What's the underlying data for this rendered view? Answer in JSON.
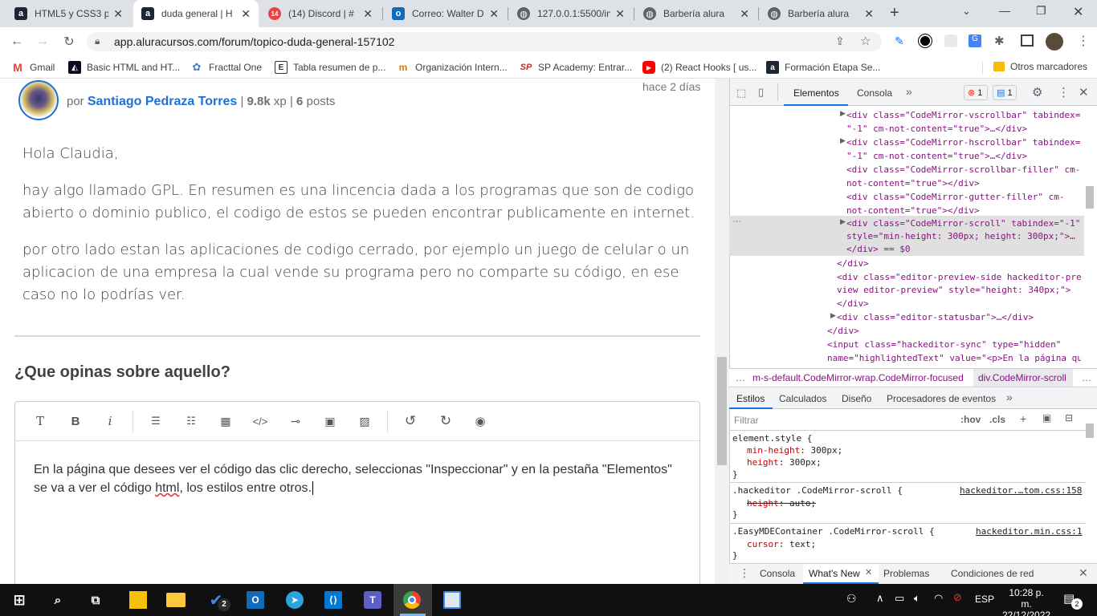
{
  "browser": {
    "tabs": [
      {
        "title": "HTML5 y CSS3 pa",
        "icon": "alura-icon",
        "active": false
      },
      {
        "title": "duda general | H",
        "icon": "alura-icon",
        "active": true
      },
      {
        "title": "(14) Discord | #",
        "icon": "discord-icon",
        "badge": "14",
        "active": false
      },
      {
        "title": "Correo: Walter D",
        "icon": "outlook-icon",
        "active": false
      },
      {
        "title": "127.0.0.1:5500/in",
        "icon": "globe-icon",
        "active": false
      },
      {
        "title": "Barbería alura",
        "icon": "globe-icon",
        "active": false
      },
      {
        "title": "Barbería alura",
        "icon": "globe-icon",
        "active": false
      }
    ],
    "url": "app.aluracursos.com/forum/topico-duda-general-157102",
    "bookmarks": [
      {
        "label": "Gmail",
        "icon": "gmail-icon"
      },
      {
        "label": "Basic HTML and HT...",
        "icon": "freecodecamp-icon"
      },
      {
        "label": "Fracttal One",
        "icon": "fracttal-icon"
      },
      {
        "label": "Tabla resumen de p...",
        "icon": "e-icon"
      },
      {
        "label": "Organización Intern...",
        "icon": "org-icon"
      },
      {
        "label": "SP Academy: Entrar...",
        "icon": "sp-icon"
      },
      {
        "label": "(2) React Hooks [ us...",
        "icon": "youtube-icon"
      },
      {
        "label": "Formación Etapa Se...",
        "icon": "alura-icon"
      }
    ],
    "other_bookmarks": "Otros marcadores"
  },
  "post": {
    "time": "hace 2 días",
    "by": "por",
    "author": "Santiago Pedraza Torres",
    "xp_value": "9.8k",
    "xp_label": "xp",
    "posts_value": "6",
    "posts_label": "posts",
    "paragraphs": [
      "Hola Claudia,",
      "hay algo llamado GPL. En resumen es una lincencia dada a los programas que son de codigo abierto o dominio publico, el codigo de estos se pueden encontrar publicamente en internet.",
      "por otro lado estan las aplicaciones de codigo cerrado, por ejemplo un juego de celular o un aplicacion de una empresa la cual vende su programa pero no comparte su código, en ese caso no lo podrías ver."
    ]
  },
  "reply": {
    "heading": "¿Que opinas sobre aquello?",
    "toolbar_icons": [
      "heading-icon",
      "bold-icon",
      "italic-icon",
      "ordered-list-icon",
      "unordered-list-icon",
      "table-icon",
      "code-icon",
      "link-icon",
      "image-icon",
      "upload-image-icon",
      "undo-icon",
      "redo-icon",
      "preview-icon"
    ],
    "text_before": "En la página que desees ver el código das clic derecho, seleccionas \"Inspeccionar\" y en la pestaña \"Elementos\" se va a ver el código ",
    "text_underlined": "html",
    "text_after": ", los estilos entre otros."
  },
  "devtools": {
    "tabs": [
      "Elementos",
      "Consola"
    ],
    "errors": "1",
    "messages": "1",
    "dom_lines": [
      "<div class=\"CodeMirror-vscrollbar\" tabindex=",
      "\"-1\" cm-not-content=\"true\">…</div>",
      "<div class=\"CodeMirror-hscrollbar\" tabindex=",
      "\"-1\" cm-not-content=\"true\">…</div>",
      "<div class=\"CodeMirror-scrollbar-filler\" cm-",
      "not-content=\"true\"></div>",
      "<div class=\"CodeMirror-gutter-filler\" cm-",
      "not-content=\"true\"></div>",
      "<div class=\"CodeMirror-scroll\" tabindex=\"-1\"",
      "style=\"min-height: 300px; height: 300px;\">…",
      "</div> == $0",
      "</div>",
      "<div class=\"editor-preview-side hackeditor-pre",
      "view editor-preview\" style=\"height: 340px;\">",
      "</div>",
      "<div class=\"editor-statusbar\">…</div>",
      "</div>",
      "<input class=\"hackeditor-sync\" type=\"hidden\"",
      "name=\"highlightedText\" value=\"<p>En la página qu"
    ],
    "breadcrumb": [
      "m-s-default.CodeMirror-wrap.CodeMirror-focused",
      "div.CodeMirror-scroll"
    ],
    "style_tabs": [
      "Estilos",
      "Calculados",
      "Diseño",
      "Procesadores de eventos"
    ],
    "filter_placeholder": "Filtrar",
    "hov": ":hov",
    "cls": ".cls",
    "rules": [
      {
        "selector": "element.style {",
        "source": "",
        "props": [
          [
            "min-height",
            "300px;"
          ],
          [
            "height",
            "300px;"
          ]
        ]
      },
      {
        "selector": ".hackeditor .CodeMirror-scroll {",
        "source": "hackeditor.…tom.css:158",
        "props": [
          [
            "height",
            "auto;"
          ]
        ]
      },
      {
        "selector": ".EasyMDEContainer .CodeMirror-scroll {",
        "source": "hackeditor.min.css:1",
        "props": [
          [
            "cursor",
            "text;"
          ]
        ]
      }
    ],
    "drawer_tabs": [
      "Consola",
      "What's New",
      "Problemas",
      "Condiciones de red"
    ]
  },
  "taskbar": {
    "lang": "ESP",
    "time": "10:28 p. m.",
    "date": "22/12/2022",
    "notifications": "2",
    "todo_badge": "2"
  }
}
